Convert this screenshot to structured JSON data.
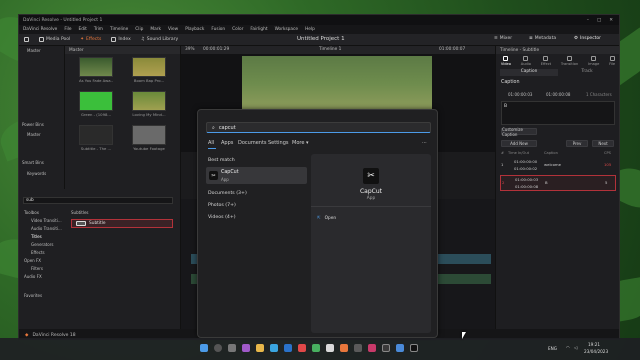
{
  "app": {
    "title": "DaVinci Resolve - Untitled Project 1",
    "menu": [
      "DaVinci Resolve",
      "File",
      "Edit",
      "Trim",
      "Timeline",
      "Clip",
      "Mark",
      "View",
      "Playback",
      "Fusion",
      "Color",
      "Fairlight",
      "Workspace",
      "Help"
    ],
    "toolbar": {
      "media_pool": "Media Pool",
      "effects": "Effects",
      "index": "Index",
      "sound_library": "Sound Library",
      "project_title": "Untitled Project 1",
      "mixer": "Mixer",
      "metadata": "Metadata",
      "inspector": "Inspector"
    },
    "status_name": "DaVinci Resolve 18"
  },
  "media_pool": {
    "master_label": "Master",
    "bin_header": "Master",
    "power_bins": "Power Bins",
    "power_master": "Master",
    "smart_bins": "Smart Bins",
    "keywords": "Keywords",
    "clips": [
      {
        "name": "As You Fade Awa..."
      },
      {
        "name": "Boom Bap Pro..."
      },
      {
        "name": "Green - (1098..."
      },
      {
        "name": "Loving My Mind..."
      },
      {
        "name": "Subtitle - The ..."
      },
      {
        "name": "Youtube Footage"
      }
    ]
  },
  "viewer": {
    "zoom": "39%",
    "timecode_left": "00:00:01:29",
    "timeline_name": "Timeline 1",
    "timecode_right": "01:00:00:07"
  },
  "effects": {
    "search_value": "sub",
    "toolbox": "Toolbox",
    "video_transitions": "Video Transiti...",
    "audio_transitions": "Audio Transiti...",
    "titles": "Titles",
    "generators": "Generators",
    "effects": "Effects",
    "openfx": "Open FX",
    "filters": "Filters",
    "audio_fx": "Audio FX",
    "favorites": "Favorites",
    "group_label": "Subtitles",
    "item": "Subtitle"
  },
  "inspector": {
    "header": "Timeline - Subtitle",
    "tabs": [
      "Video",
      "Audio",
      "Effect",
      "Transition",
      "Image",
      "File"
    ],
    "sub_tabs": [
      "Caption",
      "Track"
    ],
    "caption_label": "Caption",
    "tc_in": "01:00:00:03",
    "tc_out": "01:00:00:08",
    "characters": "1 Characters",
    "caption_text": "B",
    "customize": "Customize Caption",
    "add_new": "Add New",
    "prev": "Prev",
    "next": "Next",
    "columns": [
      "#",
      "Time In/Out",
      "Caption",
      "CPS"
    ],
    "rows": [
      {
        "num": "1",
        "in": "01:00:00:00",
        "out": "01:00:00:02",
        "caption": "welcome",
        "cps": "105"
      },
      {
        "num": "2",
        "in": "01:00:00:03",
        "out": "01:00:00:08",
        "caption": "B",
        "cps": "5"
      }
    ]
  },
  "start_menu": {
    "search_value": "capcut",
    "filters": [
      "All",
      "Apps",
      "Documents",
      "Settings",
      "More"
    ],
    "more_icon": "chevron-down-icon",
    "best_match_label": "Best match",
    "best_match_name": "CapCut",
    "best_match_type": "App",
    "documents": "Documents (3+)",
    "photos": "Photos (7+)",
    "videos": "Videos (4+)",
    "detail_name": "CapCut",
    "detail_type": "App",
    "open_action": "Open"
  },
  "taskbar": {
    "language": "ENG",
    "time": "19:21",
    "date": "23/04/2023"
  },
  "colors": {
    "accent": "#e8773c",
    "selection_red": "#b2323a",
    "windows_blue": "#4c9be8"
  }
}
